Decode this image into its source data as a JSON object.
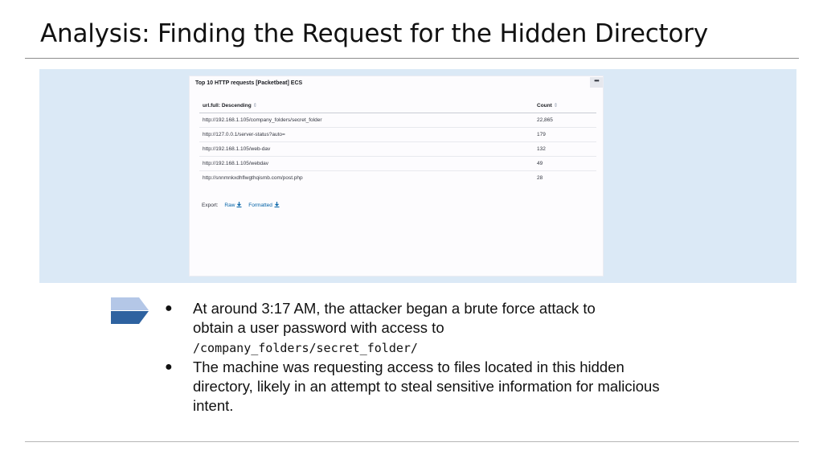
{
  "slide": {
    "title": "Analysis: Finding the Request for the Hidden Directory"
  },
  "panel": {
    "title": "Top 10 HTTP requests [Packetbeat] ECS",
    "menu_label": "•••",
    "columns": {
      "url": "url.full: Descending",
      "count": "Count"
    },
    "rows": [
      {
        "url": "http://192.168.1.105/company_folders/secret_folder",
        "count": "22,865"
      },
      {
        "url": "http://127.0.0.1/server-status?auto=",
        "count": "179"
      },
      {
        "url": "http://192.168.1.105/web-dav",
        "count": "132"
      },
      {
        "url": "http://192.168.1.105/webdav",
        "count": "49"
      },
      {
        "url": "http://snnmnkxdhflwgthqismb.com/post.php",
        "count": "28"
      }
    ],
    "export": {
      "label": "Export:",
      "raw": "Raw",
      "formatted": "Formatted"
    }
  },
  "bullets": [
    {
      "text_line1": "At around 3:17 AM, the attacker began a brute force attack to",
      "text_line2": "obtain a user password with access to",
      "code": "/company_folders/secret_folder/"
    },
    {
      "text": "The machine was requesting access to files located in this hidden directory, likely in an attempt to steal sensitive information for malicious intent."
    }
  ],
  "colors": {
    "band": "#dbe9f6",
    "link": "#0061a6",
    "arrow_top": "#b4c7e7",
    "arrow_bottom": "#2e62a0"
  },
  "icons": {
    "bullet_marker": "chevron-arrow-icon",
    "export": "download-icon",
    "panel_menu": "ellipsis-icon"
  }
}
